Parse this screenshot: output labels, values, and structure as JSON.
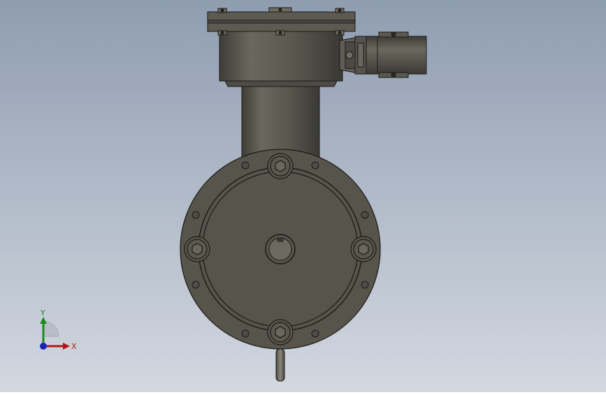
{
  "viewport": {
    "background_top": "#8f9db1",
    "background_bottom": "#d3d8e0",
    "part_color": "#56534b",
    "edge_color": "#1b1a17"
  },
  "triad": {
    "x_label": "X",
    "y_label": "Y",
    "x_color": "#b01818",
    "y_color": "#1c8a1c",
    "z_color": "#1a26b0"
  }
}
